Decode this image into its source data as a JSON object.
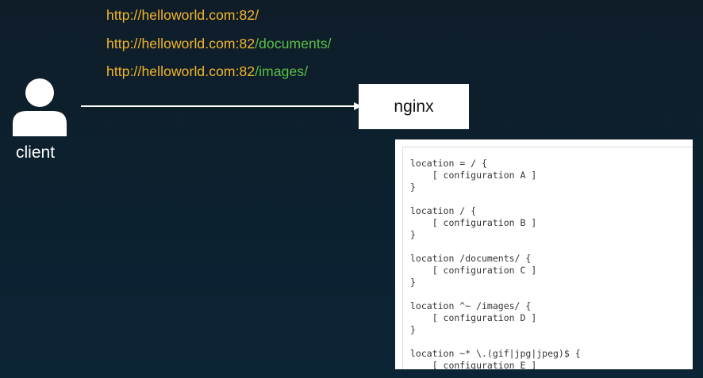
{
  "urls": [
    {
      "base": "http://helloworld.com:82/",
      "path": ""
    },
    {
      "base": "http://helloworld.com:82",
      "path": "/documents/"
    },
    {
      "base": "http://helloworld.com:82",
      "path": "/images/"
    }
  ],
  "client": {
    "label": "client",
    "icon": "user-icon"
  },
  "server": {
    "label": "nginx"
  },
  "colors": {
    "url_base": "#f2b62a",
    "url_path": "#5bbf47",
    "background": "#0e2230"
  },
  "config_blocks": [
    {
      "open": "location = / {",
      "body": "    [ configuration A ]",
      "close": "}"
    },
    {
      "open": "location / {",
      "body": "    [ configuration B ]",
      "close": "}"
    },
    {
      "open": "location /documents/ {",
      "body": "    [ configuration C ]",
      "close": "}"
    },
    {
      "open": "location ^~ /images/ {",
      "body": "    [ configuration D ]",
      "close": "}"
    },
    {
      "open": "location ~* \\.(gif|jpg|jpeg)$ {",
      "body": "    [ configuration E ]",
      "close": "}"
    }
  ]
}
